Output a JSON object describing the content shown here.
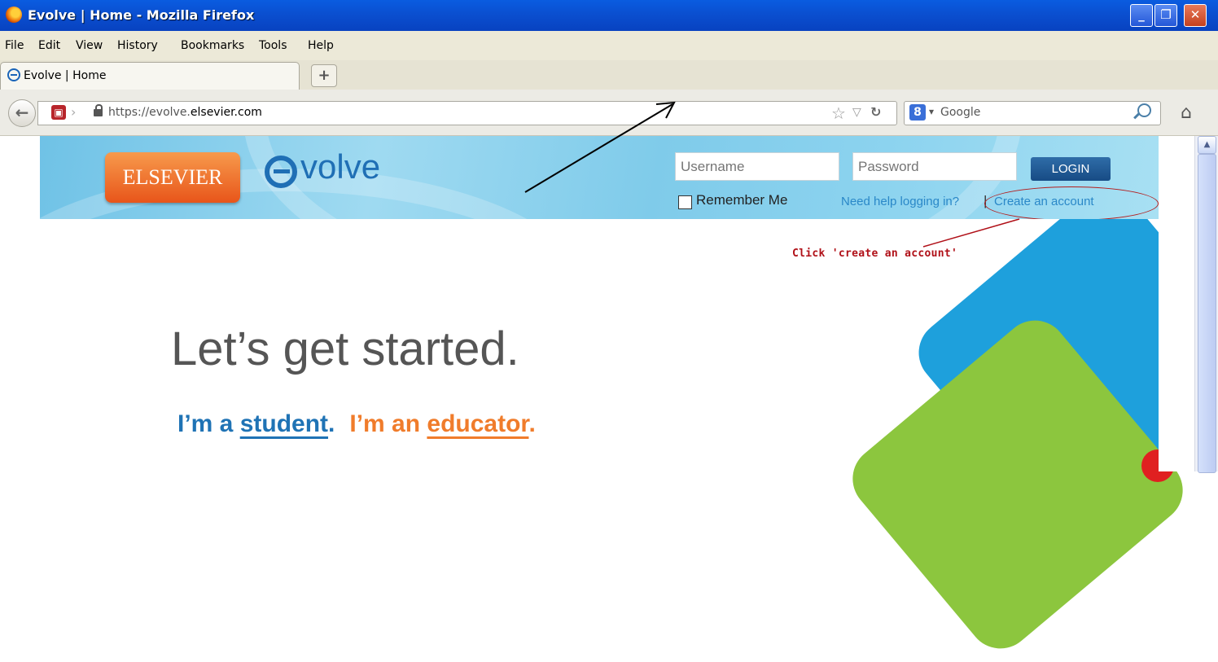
{
  "window": {
    "title": "Evolve | Home - Mozilla Firefox",
    "minimize_icon": "minimize-icon",
    "maximize_icon": "restore-icon",
    "close_icon": "close-icon"
  },
  "menu": [
    "File",
    "Edit",
    "View",
    "History",
    "Bookmarks",
    "Tools",
    "Help"
  ],
  "tab": {
    "label": "Evolve | Home",
    "new_tab_label": "+"
  },
  "url": {
    "prefix": "https://evolve.",
    "host": "elsevier.com"
  },
  "search": {
    "engine": "Google"
  },
  "page": {
    "brand_logo": "ELSEVIER",
    "product_name": "volve",
    "username_placeholder": "Username",
    "password_placeholder": "Password",
    "login_label": "LOGIN",
    "remember_label": "Remember Me",
    "help_link": "Need help logging in?",
    "separator": "|",
    "create_account": "Create an account",
    "annotation": "Click 'create an account'",
    "hero_title": "Let’s get started.",
    "student_prefix": "I’m a ",
    "student_link": "student",
    "student_suffix": ".",
    "educator_prefix": "I’m an ",
    "educator_link": "educator",
    "educator_suffix": "."
  },
  "colors": {
    "titlebar": "#0a4fd0",
    "brand_blue": "#1f6fb5",
    "brand_orange": "#f07c2b",
    "annotation_red": "#b01018",
    "header_band": "#8cd3ef"
  }
}
